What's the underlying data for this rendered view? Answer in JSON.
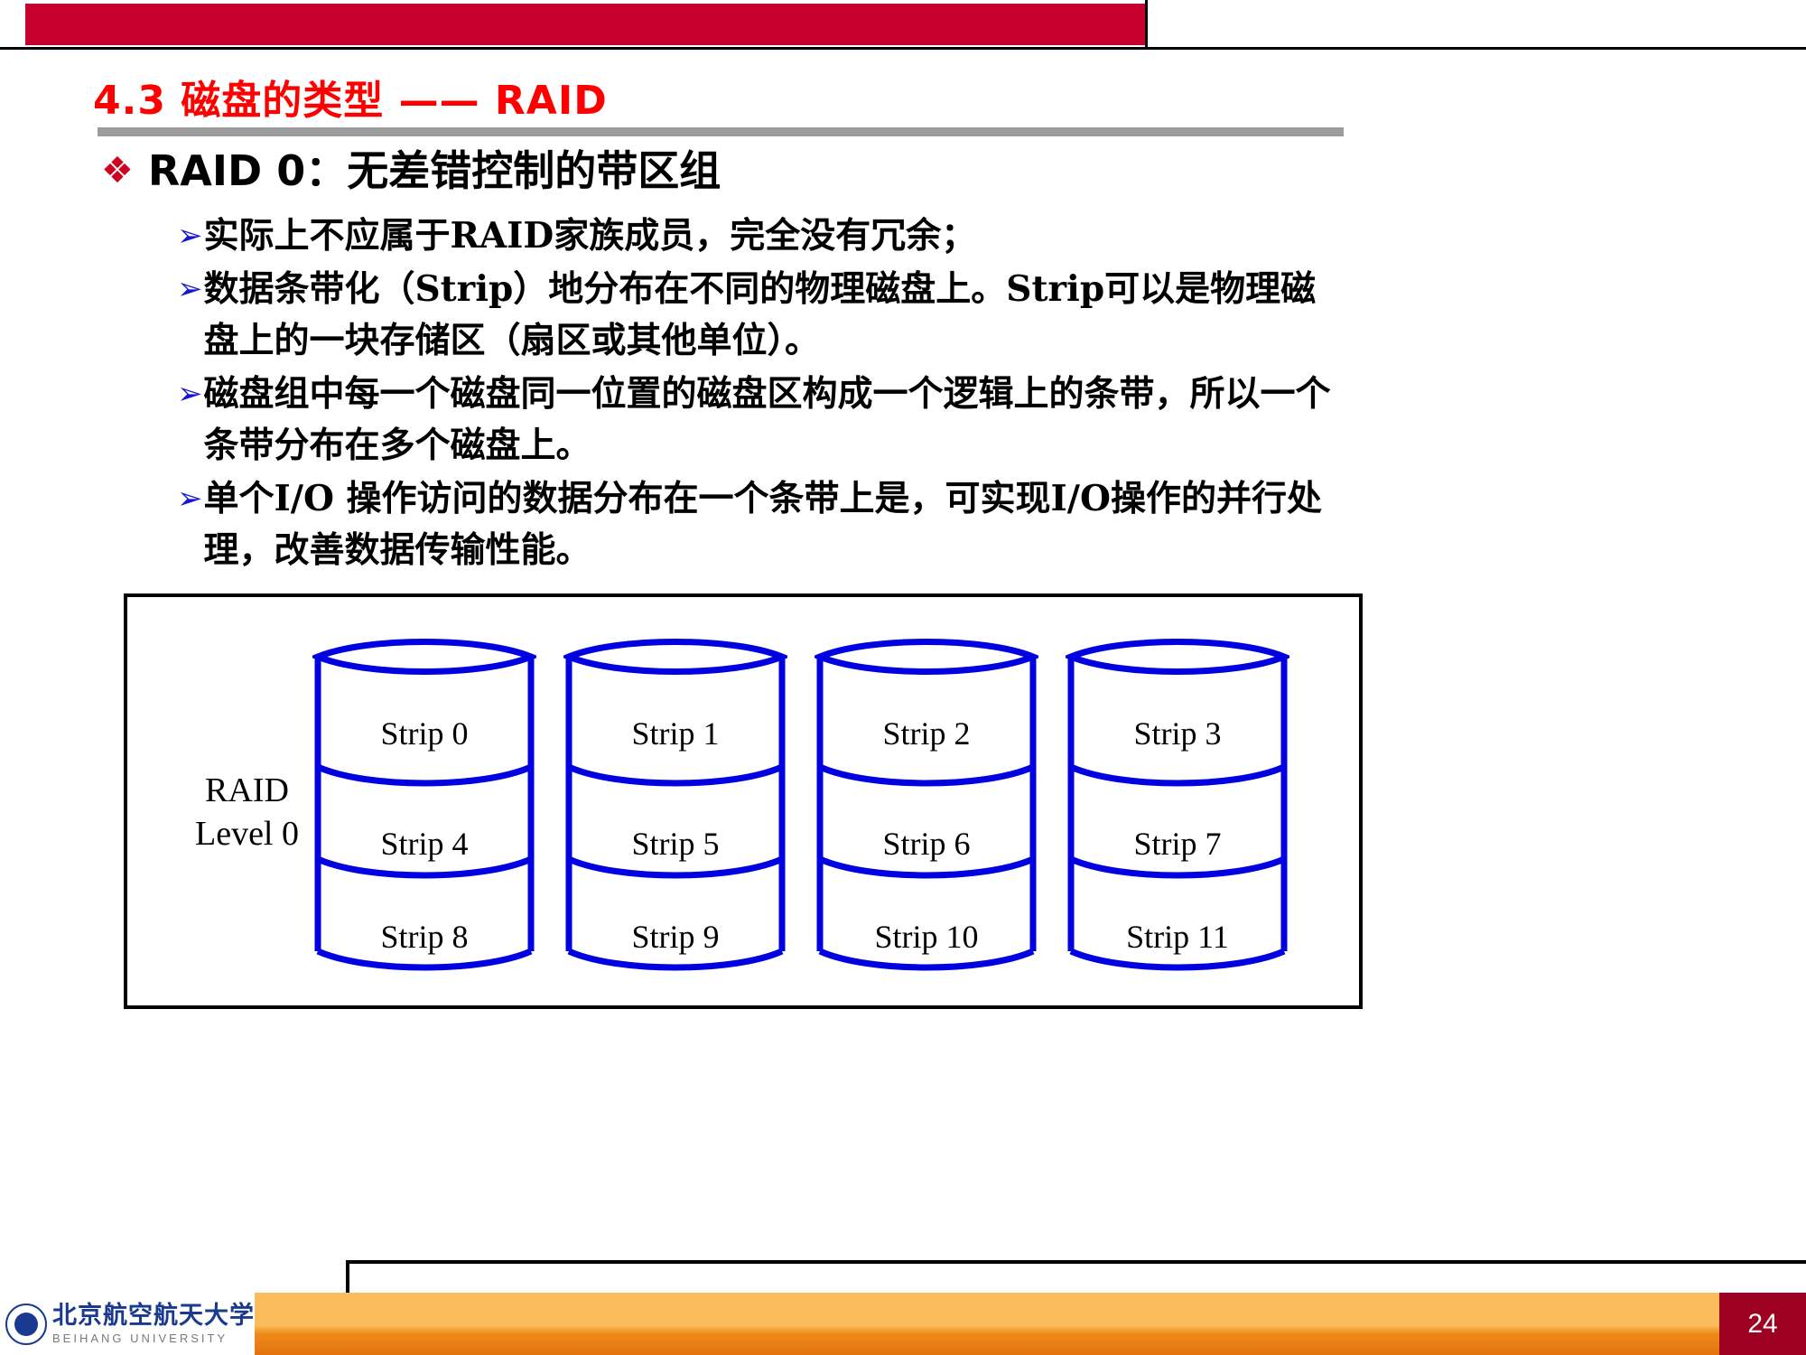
{
  "slide": {
    "title": "4.3  磁盘的类型 —— RAID",
    "heading_bullet": "❖",
    "heading": "RAID 0：无差错控制的带区组",
    "bullet_marker": "➢",
    "bullets": [
      "实际上不应属于RAID家族成员，完全没有冗余；",
      "数据条带化（Strip）地分布在不同的物理磁盘上。Strip可以是物理磁盘上的一块存储区（扇区或其他单位）。",
      "磁盘组中每一个磁盘同一位置的磁盘区构成一个逻辑上的条带，所以一个条带分布在多个磁盘上。",
      "单个I/O 操作访问的数据分布在一个条带上是，可实现I/O操作的并行处理，改善数据传输性能。"
    ]
  },
  "diagram": {
    "label_line1": "RAID",
    "label_line2": "Level 0",
    "outline_color": "#0000e0",
    "border_color": "#000000",
    "disks": [
      {
        "name": "disk-0",
        "strips": [
          "Strip 0",
          "Strip 4",
          "Strip 8"
        ]
      },
      {
        "name": "disk-1",
        "strips": [
          "Strip 1",
          "Strip 5",
          "Strip 9"
        ]
      },
      {
        "name": "disk-2",
        "strips": [
          "Strip 2",
          "Strip 6",
          "Strip 10"
        ]
      },
      {
        "name": "disk-3",
        "strips": [
          "Strip 3",
          "Strip 7",
          "Strip 11"
        ]
      }
    ]
  },
  "footer": {
    "logo_cn": "北京航空航天大学",
    "logo_en": "BEIHANG UNIVERSITY",
    "page_number": "24"
  },
  "colors": {
    "title_red": "#ff0000",
    "band_red": "#c8002e",
    "rule_gray": "#9c9c9c",
    "bullet_blue": "#1414d2",
    "diamond_red": "#d00020",
    "footer_orange": "#fbbd5c",
    "page_box_red": "#9e0022"
  }
}
